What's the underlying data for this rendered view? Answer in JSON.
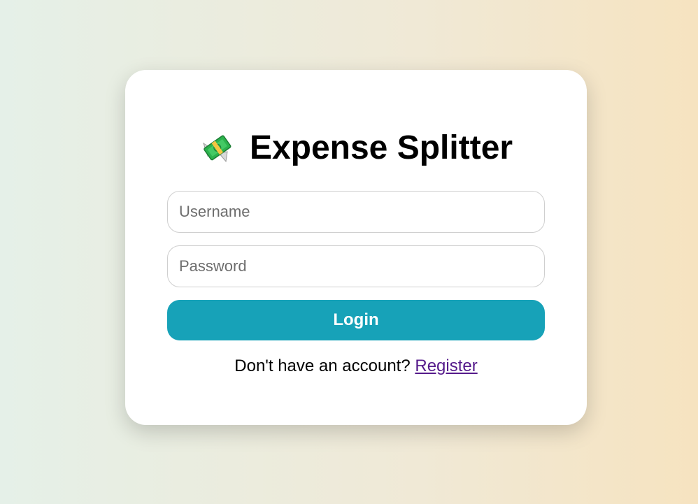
{
  "app": {
    "title": "Expense Splitter",
    "icon": "money-with-wings-icon"
  },
  "form": {
    "username_placeholder": "Username",
    "password_placeholder": "Password",
    "login_label": "Login"
  },
  "footer": {
    "prompt": "Don't have an account? ",
    "register_link": "Register"
  },
  "colors": {
    "accent": "#17a2b8",
    "link": "#551a8b",
    "background_start": "#e5f0e8",
    "background_end": "#f6e3c0"
  }
}
